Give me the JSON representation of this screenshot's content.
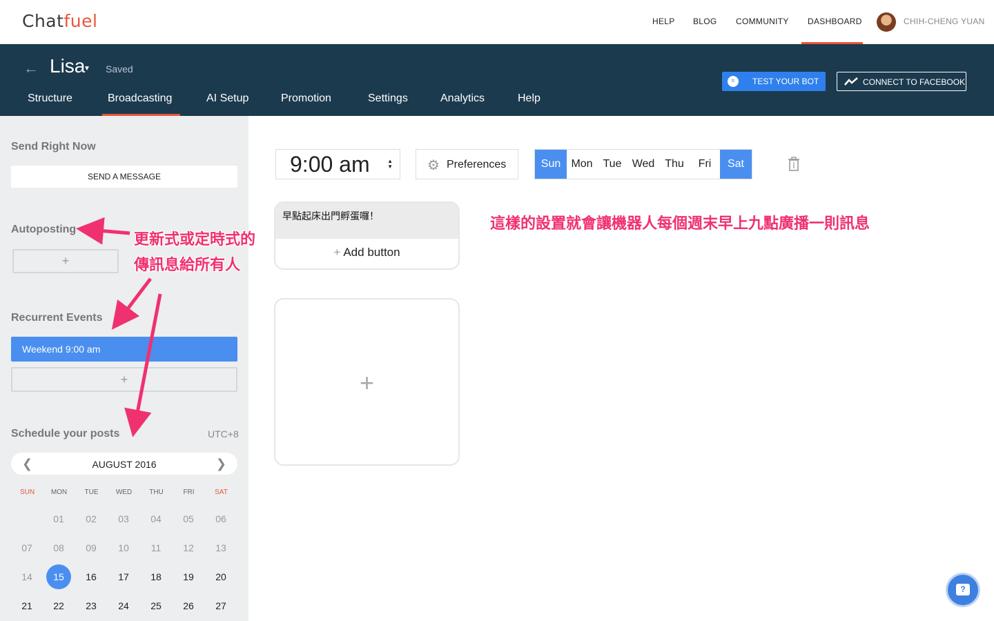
{
  "brand": {
    "logo_prefix": "Chat",
    "logo_suffix": "fuel"
  },
  "topnav": {
    "links": [
      "HELP",
      "BLOG",
      "COMMUNITY",
      "DASHBOARD"
    ],
    "user_name": "CHIH-CHENG YUAN"
  },
  "bot": {
    "name": "Lisa",
    "status": "Saved",
    "tabs": [
      "Structure",
      "Broadcasting",
      "AI Setup",
      "Promotion",
      "Settings",
      "Analytics",
      "Help"
    ],
    "active_tab": "Broadcasting",
    "test_button": "TEST YOUR BOT",
    "connect_button": "CONNECT TO FACEBOOK"
  },
  "sidebar": {
    "send_now_title": "Send Right Now",
    "send_button": "SEND A MESSAGE",
    "autoposting_title": "Autoposting",
    "add_symbol": "+",
    "recurrent_title": "Recurrent Events",
    "recurrent_event": "Weekend 9:00 am",
    "schedule_title": "Schedule your posts",
    "timezone": "UTC+8",
    "calendar": {
      "month": "AUGUST 2016",
      "weekdays": [
        "SUN",
        "MON",
        "TUE",
        "WED",
        "THU",
        "FRI",
        "SAT"
      ],
      "weeks": [
        [
          "",
          "01",
          "02",
          "03",
          "04",
          "05",
          "06"
        ],
        [
          "07",
          "08",
          "09",
          "10",
          "11",
          "12",
          "13"
        ],
        [
          "14",
          "15",
          "16",
          "17",
          "18",
          "19",
          "20"
        ],
        [
          "21",
          "22",
          "23",
          "24",
          "25",
          "26",
          "27"
        ]
      ],
      "selected_day": "15"
    }
  },
  "main": {
    "time": "9:00 am",
    "preferences_label": "Preferences",
    "days": [
      {
        "label": "Sun",
        "on": true
      },
      {
        "label": "Mon",
        "on": false
      },
      {
        "label": "Tue",
        "on": false
      },
      {
        "label": "Wed",
        "on": false
      },
      {
        "label": "Thu",
        "on": false
      },
      {
        "label": "Fri",
        "on": false
      },
      {
        "label": "Sat",
        "on": true
      }
    ],
    "message_text": "早點起床出門孵蛋囉！",
    "add_button_label": "Add button",
    "add_card_symbol": "+"
  },
  "annotations": {
    "left_line1": "更新式或定時式的",
    "left_line2": "傳訊息給所有人",
    "right": "這樣的設置就會讓機器人每個週末早上九點廣播一則訊息"
  },
  "colors": {
    "accent": "#4a8ff0",
    "brand_orange": "#e8553c",
    "header_bg": "#1c3a4e",
    "annotation": "#f0316f"
  }
}
